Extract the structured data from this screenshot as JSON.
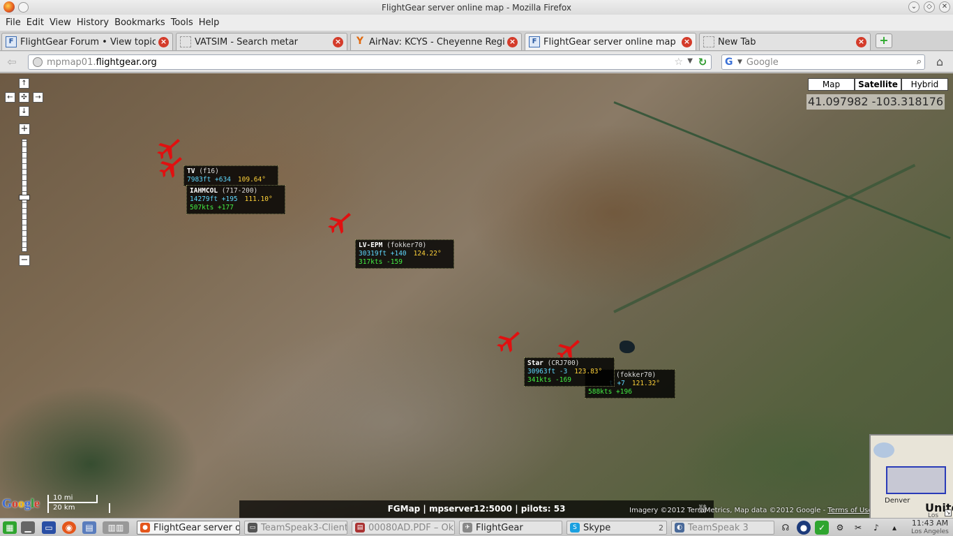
{
  "window": {
    "title": "FlightGear server online map - Mozilla Firefox"
  },
  "menu": [
    "File",
    "Edit",
    "View",
    "History",
    "Bookmarks",
    "Tools",
    "Help"
  ],
  "tabs": [
    {
      "label": "FlightGear Forum • View topic ...",
      "favicon": "F"
    },
    {
      "label": "VATSIM - Search metar",
      "favicon": ""
    },
    {
      "label": "AirNav: KCYS - Cheyenne Regio...",
      "favicon": "Y"
    },
    {
      "label": "FlightGear server online map",
      "favicon": "F"
    },
    {
      "label": "New Tab",
      "favicon": ""
    }
  ],
  "nav": {
    "url_sub": "mpmap01.",
    "url_domain": "flightgear.org",
    "search_engine": "G",
    "search_placeholder": "Google"
  },
  "map": {
    "types": [
      "Map",
      "Satellite",
      "Hybrid"
    ],
    "active_type": "Satellite",
    "coordinates": "41.097982 -103.318176",
    "zoom_level_fraction": 0.5,
    "scale": {
      "mi": "10 mi",
      "km": "20 km"
    },
    "status": "FGMap | mpserver12:5000 | pilots: 53",
    "attribution": "Imagery ©2012 TerraMetrics, Map data ©2012 Google -",
    "terms": "Terms of Use",
    "overview": {
      "city": "Denver",
      "country": "United",
      "city2": "Los Angeles"
    },
    "google_logo": [
      "G",
      "o",
      "o",
      "g",
      "l",
      "e"
    ]
  },
  "aircraft": [
    {
      "callsign": "TV",
      "type": "(f16)",
      "alt": "7983ft +634",
      "hdg": "109.64°",
      "spd": ""
    },
    {
      "callsign": "IAHMCOL",
      "type": "(717-200)",
      "alt": "14279ft +195",
      "hdg": "111.10°",
      "spd": "507kts +177"
    },
    {
      "callsign": "LV-EPM",
      "type": "(fokker70)",
      "alt": "30319ft +140",
      "hdg": "124.22°",
      "spd": "317kts -159"
    },
    {
      "callsign": "Star",
      "type": "(CRJ700)",
      "alt": "30963ft -3",
      "hdg": "123.83°",
      "spd": "341kts -169"
    },
    {
      "callsign": "",
      "type": "(fokker70)",
      "alt": "t +7",
      "hdg": "121.32°",
      "spd": "588kts +196"
    }
  ],
  "taskbar": {
    "tasks": [
      {
        "label": "FlightGear server o"
      },
      {
        "label": "TeamSpeak3-Client"
      },
      {
        "label": "00080AD.PDF – Ok"
      },
      {
        "label": "FlightGear"
      },
      {
        "label": "Skype",
        "count": "2"
      },
      {
        "label": "TeamSpeak 3"
      }
    ],
    "clock": "11:43 AM",
    "clock_location": "Los Angeles"
  },
  "colors": {
    "plane": "#e01010",
    "label_bg": "#000000",
    "alt": "#5fd8ff",
    "hdg": "#ffd23a",
    "spd": "#44ee44"
  }
}
